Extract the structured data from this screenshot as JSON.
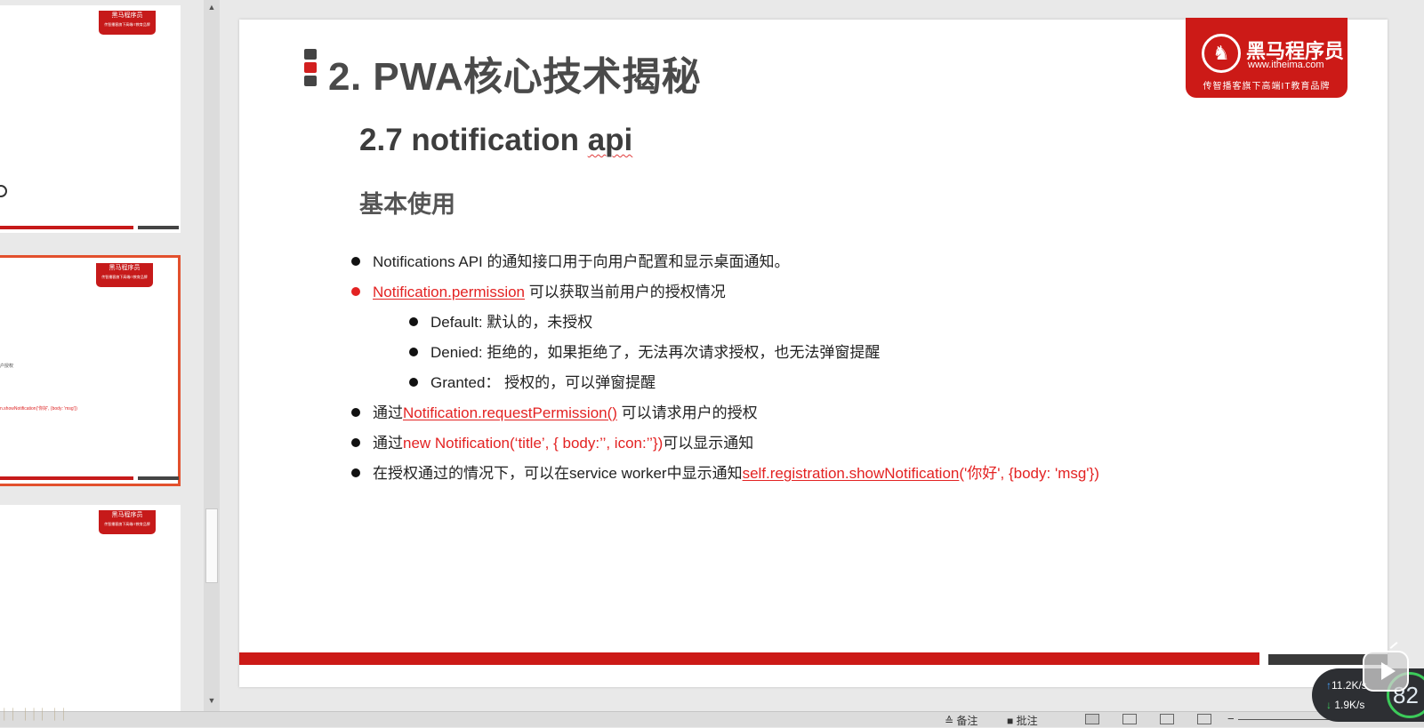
{
  "slide": {
    "title": "2. PWA核心技术揭秘",
    "section": {
      "number": "2.7 notification ",
      "word": "api"
    },
    "subheading": "基本使用",
    "logo": {
      "name": "黑马程序员",
      "url": "www.itheima.com",
      "tagline": "传智播客旗下高端IT教育品牌"
    },
    "bullets": {
      "b1": "Notifications API 的通知接口用于向用户配置和显示桌面通知。",
      "b2_link": "Notification.permission",
      "b2_text": " 可以获取当前用户的授权情况",
      "b2a": "Default: 默认的，未授权",
      "b2b": "Denied: 拒绝的，如果拒绝了，无法再次请求授权，也无法弹窗提醒",
      "b2c": "Granted：  授权的，可以弹窗提醒",
      "b3_pre": "通过",
      "b3_link": "Notification.requestPermission()",
      "b3_post": " 可以请求用户的授权",
      "b4_pre": "通过",
      "b4_red": "new Notification(‘title’, { body:’’, icon:’’})",
      "b4_post": "可以显示通知",
      "b5_pre": "在授权通过的情况下，可以在service worker中显示通知",
      "b5_link": "self.registration.showNotification",
      "b5_red": "('你好', {body: 'msg'})"
    }
  },
  "thumbnails": {
    "logo_name": "黑马程序员",
    "logo_sub": "传智播客旗下高端IT教育品牌",
    "t2_text1": "户授权",
    "t2_text2": "n.showNotification('你好', {body: 'msg'})"
  },
  "statusbar": {
    "notes": "备注",
    "comments": "批注"
  },
  "network": {
    "up": "11.2K/s",
    "down": "1.9K/s",
    "percent": "82"
  },
  "colors": {
    "brand_red": "#cc1a17",
    "link_red": "#e32222",
    "title_gray": "#4a4a4a"
  },
  "icons": {
    "play": "play-icon",
    "notes": "notes-icon",
    "comments": "comments-icon"
  }
}
